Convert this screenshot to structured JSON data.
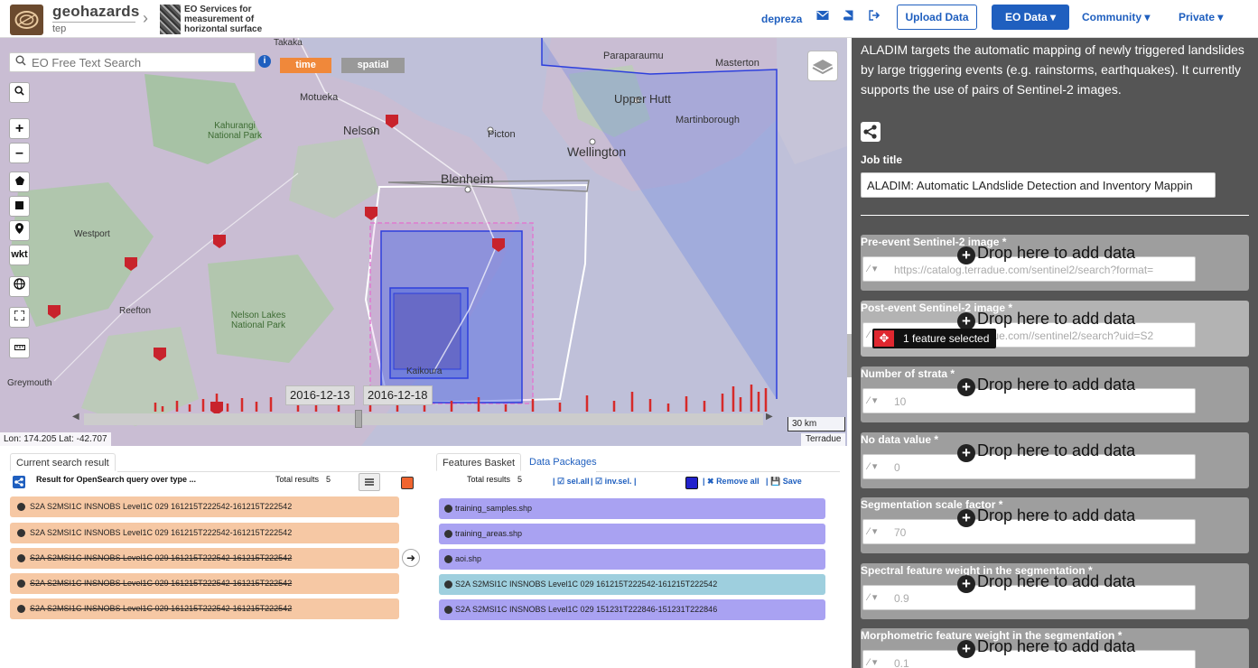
{
  "header": {
    "brand": "geohazards",
    "brand_sub": "tep",
    "service_title_1": "EO Services for",
    "service_title_2": "measurement of",
    "service_title_3": "horizontal surface",
    "user": "depreza",
    "upload_label": "Upload Data",
    "eo_data_label": "EO Data ▾",
    "community_label": "Community ▾",
    "private_label": "Private ▾"
  },
  "map": {
    "search_placeholder": "EO Free Text Search",
    "time_label": "time",
    "spatial_label": "spatial",
    "wkt_label": "wkt",
    "place_labels": [
      "Takaka",
      "Paraparaumu",
      "Masterton",
      "Motueka",
      "Upper Hutt",
      "Kahurangi National Park",
      "Nelson",
      "Picton",
      "Martinborough",
      "Wellington",
      "Blenheim",
      "Westport",
      "Nelson Lakes National Park",
      "Reefton",
      "Kaikoura",
      "Greymouth"
    ],
    "date_start": "2016-12-13",
    "date_end": "2016-12-18",
    "scale": "30 km",
    "coords": "Lon: 174.205 Lat: -42.707",
    "attribution": "Terradue"
  },
  "search_panel": {
    "tab_label": "Current search result",
    "query_label": "Result for OpenSearch query over type ...",
    "total_label": "Total results",
    "total_value": "5",
    "rows": [
      {
        "text": "S2A S2MSI1C INSNOBS Level1C 029 161215T222542-161215T222542",
        "strike": false
      },
      {
        "text": "S2A S2MSI1C INSNOBS Level1C 029 161215T222542-161215T222542",
        "strike": false
      },
      {
        "text": "S2A S2MSI1C INSNOBS Level1C 029 161215T222542-161215T222542",
        "strike": true
      },
      {
        "text": "S2A S2MSI1C INSNOBS Level1C 029 161215T222542-161215T222542",
        "strike": true
      },
      {
        "text": "S2A S2MSI1C INSNOBS Level1C 029 161215T222542-161215T222542",
        "strike": true
      }
    ]
  },
  "basket_panel": {
    "tab_basket": "Features Basket",
    "tab_packages": "Data Packages",
    "total_label": "Total results",
    "total_value": "5",
    "sel_all": "sel.all",
    "inv_sel": "inv.sel.",
    "remove_all": "Remove all",
    "save": "Save",
    "rows": [
      {
        "text": "training_samples.shp",
        "kind": "purple"
      },
      {
        "text": "training_areas.shp",
        "kind": "purple"
      },
      {
        "text": "aoi.shp",
        "kind": "purple"
      },
      {
        "text": "S2A S2MSI1C INSNOBS Level1C 029 161215T222542-161215T222542",
        "kind": "teal"
      },
      {
        "text": "S2A S2MSI1C INSNOBS Level1C 029 151231T222846-151231T222846",
        "kind": "purple"
      }
    ]
  },
  "service_panel": {
    "description": "ALADIM targets the automatic mapping of newly triggered landslides by large triggering events (e.g. rainstorms, earthquakes). It currently supports the use of pairs of Sentinel-2 images.",
    "job_title_label": "Job title",
    "job_title_value": "ALADIM: Automatic LAndslide Detection and Inventory Mappin",
    "drop_label": "Drop here to add data",
    "feature_tip": "1 feature selected",
    "fields": [
      {
        "label": "Pre-event Sentinel-2 image *",
        "value": "https://catalog.terradue.com/sentinel2/search?format="
      },
      {
        "label": "Post-event Sentinel-2 image *",
        "value": "https://catalog.terradue.com//sentinel2/search?uid=S2"
      },
      {
        "label": "Number of strata *",
        "value": "10"
      },
      {
        "label": "No data value *",
        "value": "0"
      },
      {
        "label": "Segmentation scale factor *",
        "value": "70"
      },
      {
        "label": "Spectral feature weight in the segmentation *",
        "value": "0.9"
      },
      {
        "label": "Morphometric feature weight in the segmentation *",
        "value": "0.1"
      }
    ]
  },
  "colors": {
    "accent": "#1f5fbf",
    "orange": "#f0883a",
    "row_orange": "#f6c8a4",
    "row_purple": "#a9a2f2",
    "row_teal": "#9ecfde",
    "panel_bg": "#555555"
  }
}
